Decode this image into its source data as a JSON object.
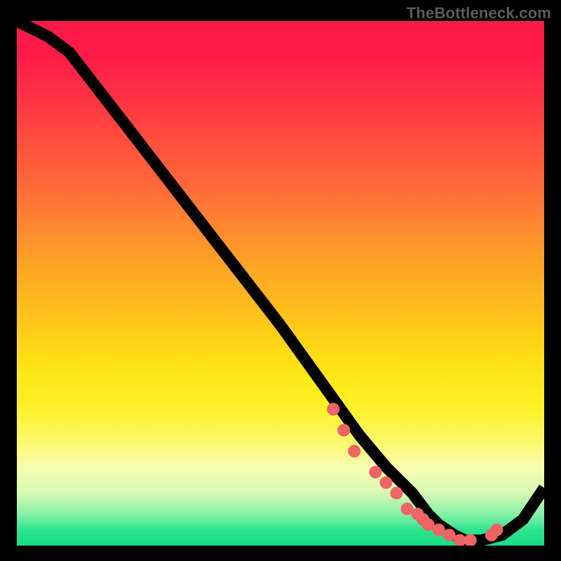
{
  "watermark": "TheBottleneck.com",
  "chart_data": {
    "type": "line",
    "title": "",
    "xlabel": "",
    "ylabel": "",
    "xlim": [
      0,
      100
    ],
    "ylim": [
      0,
      100
    ],
    "grid": false,
    "series": [
      {
        "name": "curve",
        "x": [
          0,
          6,
          10,
          20,
          30,
          40,
          50,
          55,
          60,
          65,
          70,
          75,
          78,
          80,
          83,
          85,
          88,
          92,
          96,
          100
        ],
        "y": [
          100,
          97,
          94,
          81,
          68,
          55,
          42,
          35,
          28,
          21,
          15,
          10,
          6,
          4,
          2,
          1,
          1,
          2,
          5,
          11
        ]
      }
    ],
    "markers": {
      "x": [
        60,
        62,
        64,
        68,
        70,
        72,
        74,
        76,
        77,
        78,
        80,
        82,
        84,
        86,
        90,
        91
      ],
      "y": [
        26,
        22,
        18,
        14,
        12,
        10,
        7,
        6,
        5,
        4,
        3,
        2,
        1,
        1,
        2,
        3
      ]
    },
    "gradient_stops": [
      {
        "pos": 0.0,
        "color": "#ff1a49"
      },
      {
        "pos": 0.06,
        "color": "#ff1a49"
      },
      {
        "pos": 0.16,
        "color": "#ff3744"
      },
      {
        "pos": 0.32,
        "color": "#ff6c39"
      },
      {
        "pos": 0.46,
        "color": "#ffa227"
      },
      {
        "pos": 0.58,
        "color": "#ffc91a"
      },
      {
        "pos": 0.66,
        "color": "#ffe414"
      },
      {
        "pos": 0.74,
        "color": "#fff22a"
      },
      {
        "pos": 0.8,
        "color": "#fbf96a"
      },
      {
        "pos": 0.85,
        "color": "#f8fcb0"
      },
      {
        "pos": 0.9,
        "color": "#d8f9b4"
      },
      {
        "pos": 0.94,
        "color": "#86f0a7"
      },
      {
        "pos": 0.97,
        "color": "#2fe38f"
      },
      {
        "pos": 1.0,
        "color": "#17dd86"
      }
    ]
  }
}
